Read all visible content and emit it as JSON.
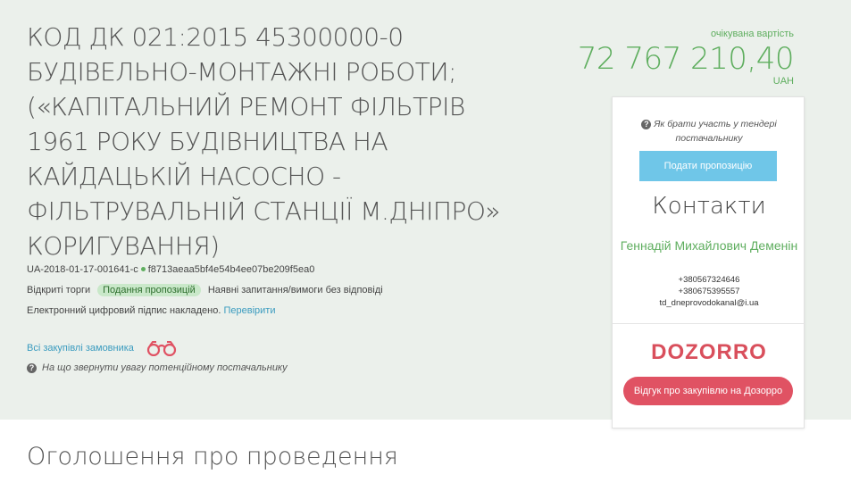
{
  "tender": {
    "title": "КОД ДК 021:2015 45300000-0 БУДІВЕЛЬНО-МОНТАЖНІ РОБОТИ; («КАПІТАЛЬНИЙ РЕМОНТ ФІЛЬТРІВ 1961 РОКУ БУДІВНИЦТВА НА КАЙДАЦЬКІЙ НАСОСНО - ФІЛЬТРУВАЛЬНІЙ СТАНЦІЇ М.ДНІПРО» КОРИГУВАННЯ)",
    "id": "UA-2018-01-17-001641-c",
    "hash": "f8713aeaa5bf4e54b4ee07be209f5ea0",
    "procedure": "Відкриті торги",
    "status_badge": "Подання пропозицій",
    "questions_status": "Наявні запитання/вимоги без відповіді",
    "signature_text": "Електронний цифровий підпис накладено.",
    "verify_link": "Перевірити",
    "all_purchases_link": "Всі закупівлі замовника",
    "attention_text": "На що звернути увагу потенційному постачальнику"
  },
  "price": {
    "label": "очікувана вартість",
    "value": "72 767 210,40",
    "currency": "UAH"
  },
  "sidebar": {
    "howto_text": "Як брати участь у тендері постачальнику",
    "submit_button": "Подати пропозицію",
    "contacts_title": "Контакти",
    "contact_name": "Геннадій Михайлович Деменін",
    "phone1": "+380567324646",
    "phone2": "+380675395557",
    "email": "td_dneprovodokanal@i.ua",
    "dozorro_logo": "DOZORRO",
    "dozorro_button": "Відгук про закупівлю на Дозорро"
  },
  "section": {
    "announcement_title": "Оголошення про проведення"
  },
  "colors": {
    "accent_green": "#5fae5f",
    "link_blue": "#3a9bbf",
    "submit_blue": "#6fc6e8",
    "dozorro_red": "#e05263"
  }
}
